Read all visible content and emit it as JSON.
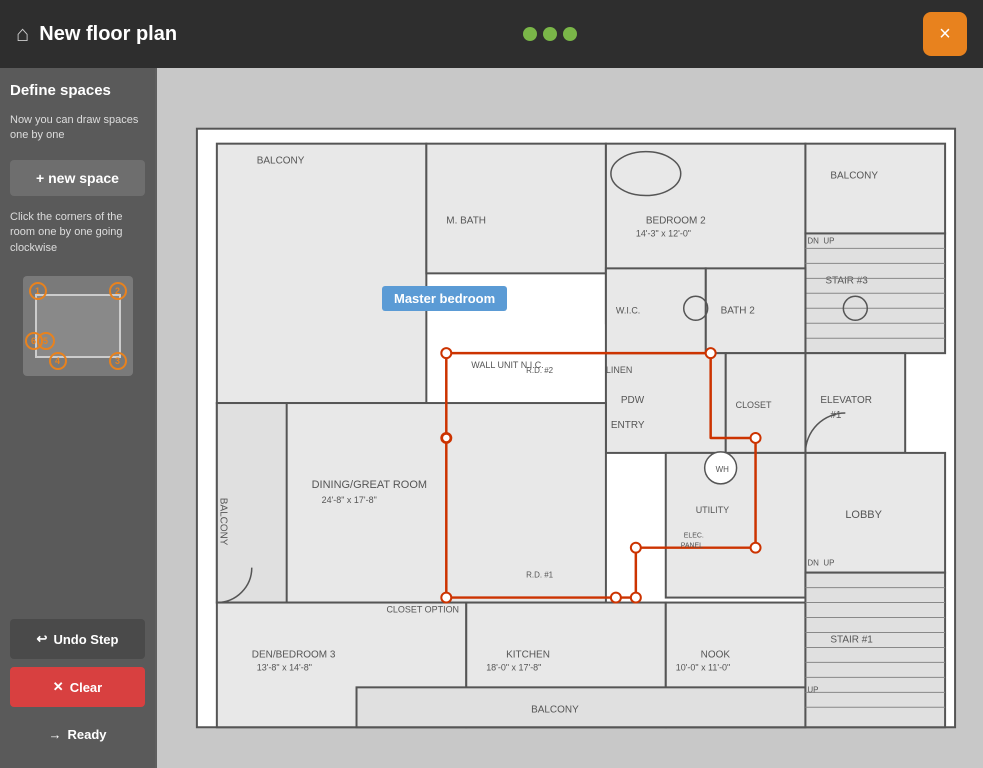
{
  "header": {
    "title": "New floor plan",
    "close_label": "×"
  },
  "sidebar": {
    "define_spaces_title": "Define spaces",
    "define_spaces_desc": "Now you can draw spaces one by one",
    "new_space_label": "+ new space",
    "instructions": "Click the corners of the room one by one going clockwise",
    "undo_label": "Undo Step",
    "clear_label": "Clear",
    "ready_label": "Ready"
  },
  "floorplan": {
    "master_bedroom_label": "Master bedroom"
  }
}
